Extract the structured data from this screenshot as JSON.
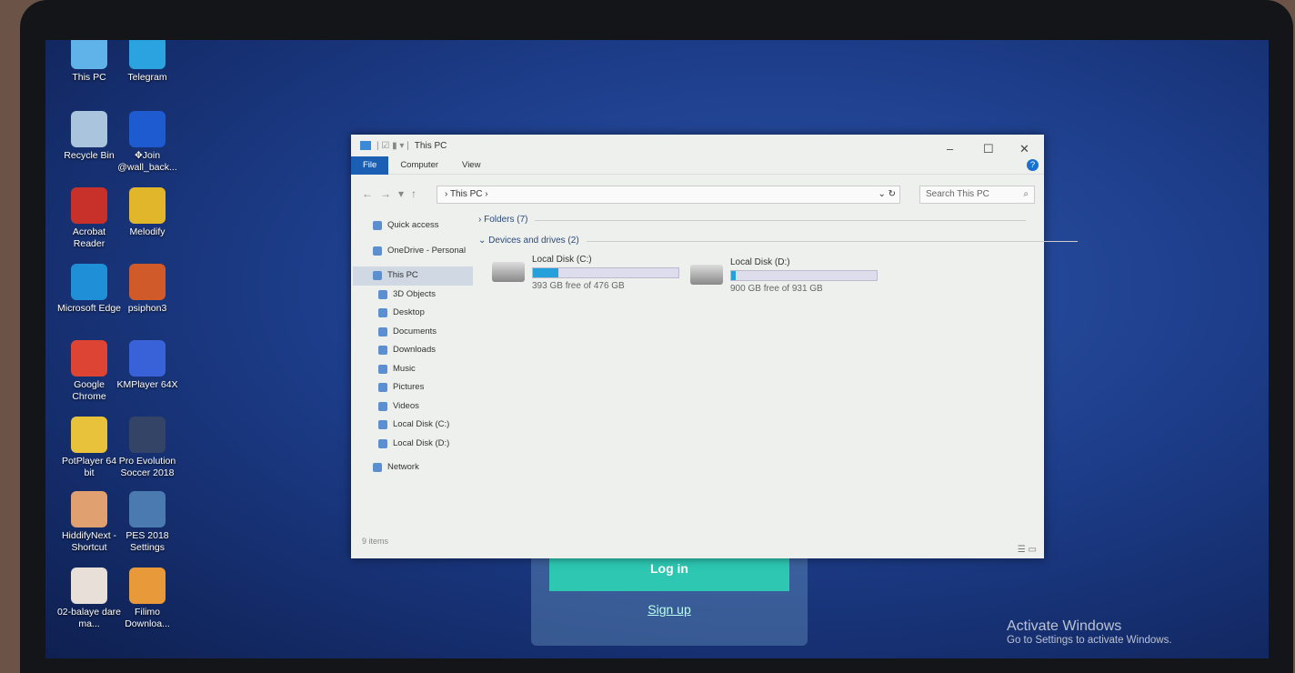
{
  "desktop": {
    "icons": [
      {
        "label": "This PC",
        "color": "#5fb3e8"
      },
      {
        "label": "Telegram",
        "color": "#2aa3e0"
      },
      {
        "label": "Recycle Bin",
        "color": "#aac4dd"
      },
      {
        "label": "✥Join @wall_back...",
        "color": "#1e5bd0"
      },
      {
        "label": "Acrobat Reader",
        "color": "#c8302a"
      },
      {
        "label": "Melodify",
        "color": "#e2b62a"
      },
      {
        "label": "Microsoft Edge",
        "color": "#1f8fd8"
      },
      {
        "label": "psiphon3",
        "color": "#d05a2a"
      },
      {
        "label": "Google Chrome",
        "color": "#dd4433"
      },
      {
        "label": "KMPlayer 64X",
        "color": "#3a62d8"
      },
      {
        "label": "PotPlayer 64 bit",
        "color": "#e8c23a"
      },
      {
        "label": "Pro Evolution Soccer 2018",
        "color": "#334466"
      },
      {
        "label": "HiddifyNext - Shortcut",
        "color": "#e0a070"
      },
      {
        "label": "PES 2018 Settings",
        "color": "#4a7ab0"
      },
      {
        "label": "02-balaye dare ma...",
        "color": "#e8e0d8"
      },
      {
        "label": "Filimo Downloa...",
        "color": "#e89a3a"
      }
    ]
  },
  "explorer": {
    "title": "This PC",
    "ribbon": [
      "File",
      "Computer",
      "View"
    ],
    "address": "This PC",
    "search_placeholder": "Search This PC",
    "sidebar": [
      {
        "label": "Quick access",
        "top": true
      },
      {
        "label": "OneDrive - Personal",
        "top": true
      },
      {
        "label": "This PC",
        "top": true,
        "selected": true
      },
      {
        "label": "3D Objects"
      },
      {
        "label": "Desktop"
      },
      {
        "label": "Documents"
      },
      {
        "label": "Downloads"
      },
      {
        "label": "Music"
      },
      {
        "label": "Pictures"
      },
      {
        "label": "Videos"
      },
      {
        "label": "Local Disk (C:)"
      },
      {
        "label": "Local Disk (D:)"
      },
      {
        "label": "Network",
        "top": true
      }
    ],
    "folders_header": "Folders (7)",
    "devices_header": "Devices and drives (2)",
    "drives": [
      {
        "name": "Local Disk (C:)",
        "free": "393 GB free of 476 GB",
        "used_fraction": 0.174
      },
      {
        "name": "Local Disk (D:)",
        "free": "900 GB free of 931 GB",
        "used_fraction": 0.033
      }
    ],
    "status": "9 items",
    "accent": "#1a5fb4"
  },
  "login_card": {
    "login": "Log in",
    "signup": "Sign up",
    "button_color": "#2dc7b2"
  },
  "watermark": {
    "title": "Activate Windows",
    "subtitle": "Go to Settings to activate Windows."
  }
}
